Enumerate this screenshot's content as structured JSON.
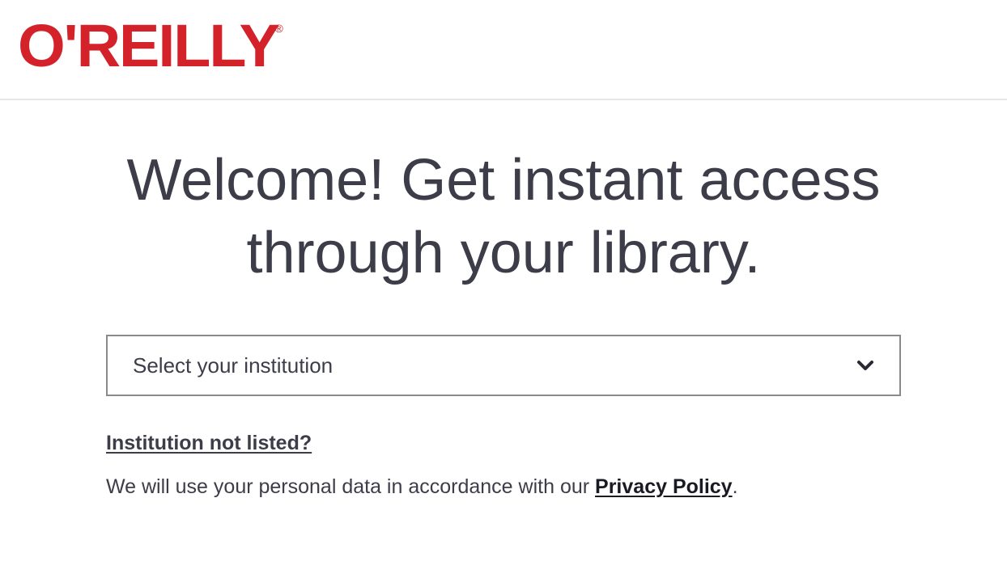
{
  "header": {
    "logo_text": "O'REILLY",
    "logo_registered": "®",
    "brand_color": "#d3222a"
  },
  "main": {
    "headline_line1": "Welcome! Get instant access",
    "headline_line2": "through your library.",
    "institution_select": {
      "selected_value": "Select your institution",
      "icon": "chevron-down-icon"
    },
    "not_listed_link": "Institution not listed?",
    "privacy_text_before": "We will use your personal data in accordance with our ",
    "privacy_link": "Privacy Policy",
    "privacy_text_after": "."
  }
}
